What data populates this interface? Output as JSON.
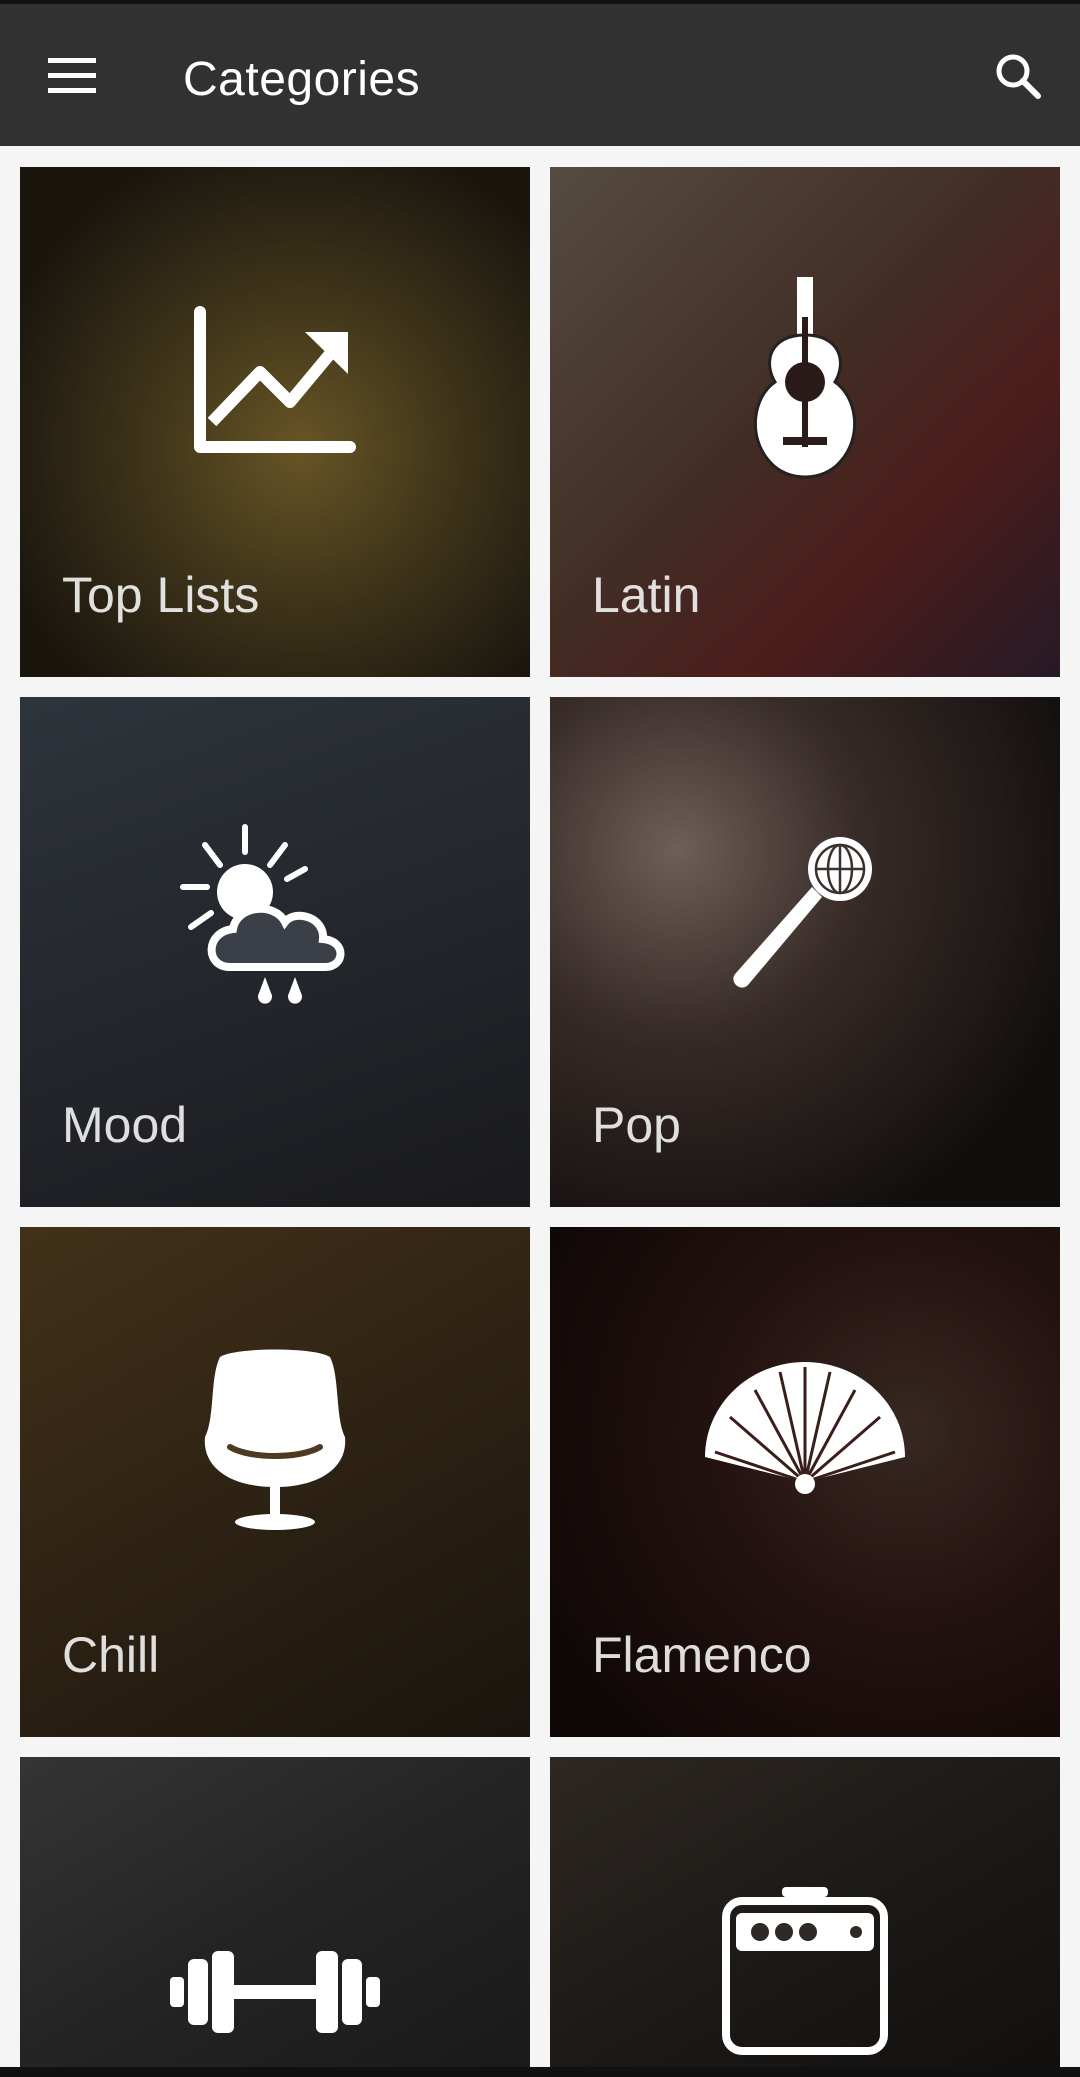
{
  "app_bar": {
    "title": "Categories",
    "menu_icon": "hamburger-menu-icon",
    "search_icon": "search-icon",
    "background": "#313131"
  },
  "categories": [
    {
      "label": "Top Lists",
      "icon": "trending-chart-icon",
      "tint": "#6b5a2c"
    },
    {
      "label": "Latin",
      "icon": "guitar-icon",
      "tint": "#5b4438"
    },
    {
      "label": "Mood",
      "icon": "sun-cloud-rain-icon",
      "tint": "#3d4450"
    },
    {
      "label": "Pop",
      "icon": "microphone-icon",
      "tint": "#3a302d"
    },
    {
      "label": "Chill",
      "icon": "egg-chair-icon",
      "tint": "#4d3a20"
    },
    {
      "label": "Flamenco",
      "icon": "hand-fan-icon",
      "tint": "#3a1e1a"
    },
    {
      "label": "",
      "icon": "dumbbell-icon",
      "tint": "#3b3b3b"
    },
    {
      "label": "",
      "icon": "amplifier-icon",
      "tint": "#2f2a26"
    }
  ]
}
